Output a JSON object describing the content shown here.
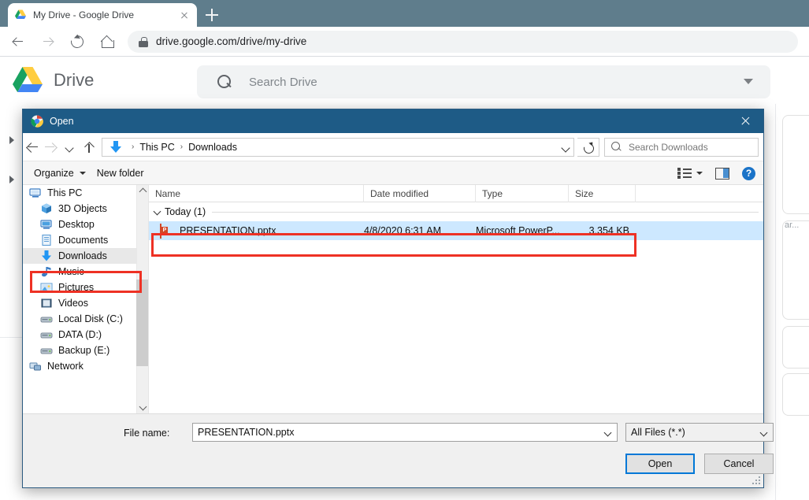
{
  "browser": {
    "tab": {
      "title": "My Drive - Google Drive",
      "favicon": "google-drive-icon",
      "close": "close-icon"
    },
    "new_tab_label": "+",
    "nav": {
      "back": "back-arrow-icon",
      "forward": "forward-arrow-icon",
      "reload": "reload-icon",
      "home": "home-icon"
    },
    "address": {
      "lock": "lock-icon",
      "url": "drive.google.com/drive/my-drive"
    }
  },
  "drive": {
    "logo": "google-drive-logo",
    "app_name": "Drive",
    "search": {
      "icon": "search-icon",
      "placeholder": "Search Drive",
      "caret": "chevron-down-icon"
    },
    "card_text": "ar..."
  },
  "dialog": {
    "title": "Open",
    "title_icon": "chrome-icon",
    "close": "close-icon",
    "nav": {
      "back": "back-arrow-icon",
      "forward": "forward-arrow-icon",
      "recent": "chevron-down-icon",
      "up": "up-arrow-icon"
    },
    "breadcrumb": {
      "icon": "downloads-icon",
      "items": [
        "This PC",
        "Downloads"
      ],
      "separator": "›",
      "caret": "chevron-down-icon"
    },
    "refresh": "refresh-icon",
    "search": {
      "icon": "search-icon",
      "placeholder": "Search Downloads"
    },
    "toolbar": {
      "organize": "Organize",
      "new_folder": "New folder",
      "view_icon": "view-options-icon",
      "pane_icon": "preview-pane-icon",
      "help_icon": "help-icon",
      "help_glyph": "?"
    },
    "nav_pane": {
      "items": [
        {
          "label": "This PC",
          "icon": "computer-icon",
          "indent": 8,
          "selected": false
        },
        {
          "label": "3D Objects",
          "icon": "3d-objects-icon",
          "indent": 22,
          "selected": false
        },
        {
          "label": "Desktop",
          "icon": "desktop-icon",
          "indent": 22,
          "selected": false
        },
        {
          "label": "Documents",
          "icon": "documents-icon",
          "indent": 22,
          "selected": false
        },
        {
          "label": "Downloads",
          "icon": "downloads-icon",
          "indent": 22,
          "selected": true
        },
        {
          "label": "Music",
          "icon": "music-icon",
          "indent": 22,
          "selected": false
        },
        {
          "label": "Pictures",
          "icon": "pictures-icon",
          "indent": 22,
          "selected": false
        },
        {
          "label": "Videos",
          "icon": "videos-icon",
          "indent": 22,
          "selected": false
        },
        {
          "label": "Local Disk (C:)",
          "icon": "drive-icon",
          "indent": 22,
          "selected": false
        },
        {
          "label": "DATA (D:)",
          "icon": "drive-icon",
          "indent": 22,
          "selected": false
        },
        {
          "label": "Backup (E:)",
          "icon": "drive-icon",
          "indent": 22,
          "selected": false
        },
        {
          "label": "Network",
          "icon": "network-icon",
          "indent": 8,
          "selected": false
        }
      ]
    },
    "file_list": {
      "columns": [
        "Name",
        "Date modified",
        "Type",
        "Size"
      ],
      "group": {
        "label": "Today (1)",
        "chevron": "chevron-down-icon"
      },
      "rows": [
        {
          "name": "PRESENTATION.pptx",
          "date_modified": "4/8/2020 6:31 AM",
          "type": "Microsoft PowerP...",
          "size": "3,354 KB",
          "icon": "powerpoint-icon",
          "icon_glyph": "P",
          "selected": true
        }
      ]
    },
    "footer": {
      "file_name_label": "File name:",
      "file_name_value": "PRESENTATION.pptx",
      "file_type_value": "All Files (*.*)",
      "open_label": "Open",
      "cancel_label": "Cancel"
    }
  },
  "colors": {
    "dialog_title_bar": "#1e5b86",
    "annotation": "#ee3124",
    "selection": "#cde8ff",
    "focus_border": "#0078d7",
    "tabstrip": "#5f7d8c"
  }
}
